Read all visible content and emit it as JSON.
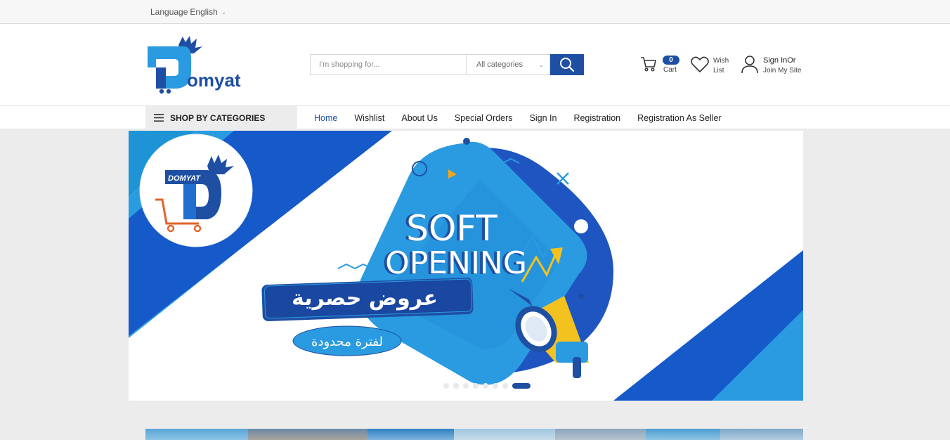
{
  "topbar": {
    "language_label": "Language",
    "language_value": "English"
  },
  "logo": {
    "text": "omyat"
  },
  "search": {
    "placeholder": "I'm shopping for...",
    "category": "All categories"
  },
  "cart": {
    "count": "0",
    "label": "Cart"
  },
  "wishlist": {
    "label": "Wish List"
  },
  "account": {
    "line1": "Sign InOr",
    "line2": "Join My Site"
  },
  "nav": {
    "shop_by_categories": "SHOP BY CATEGORIES",
    "items": [
      "Home",
      "Wishlist",
      "About Us",
      "Special Orders",
      "Sign In",
      "Registration",
      "Registration As Seller"
    ]
  },
  "banner": {
    "badge_text": "DOMYAT",
    "headline1": "SOFT",
    "headline2": "OPENING",
    "arabic_main": "عروض حصرية",
    "arabic_sub": "لفترة محدودة",
    "slides": 8,
    "active_slide": 8
  },
  "colors": {
    "brand": "#1e4fa3",
    "accent": "#2a9be0"
  }
}
